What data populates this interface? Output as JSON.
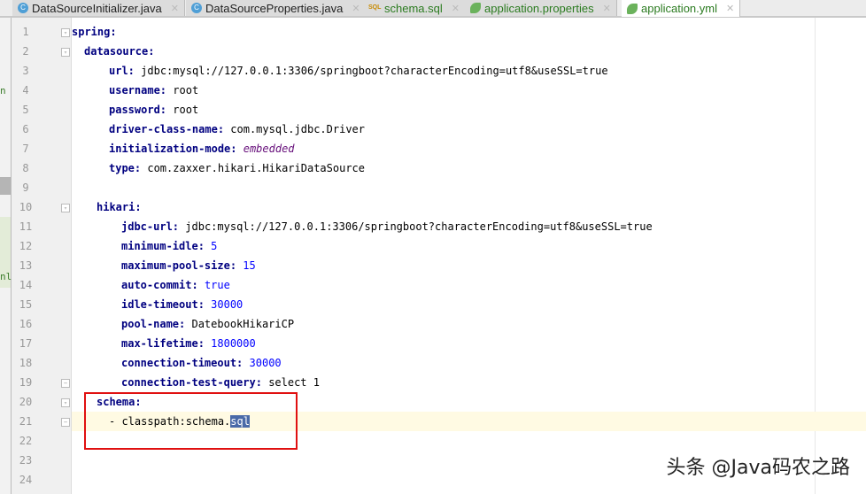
{
  "tabs": [
    {
      "label": "DataSourceInitializer.java",
      "icon": "java-class-icon"
    },
    {
      "label": "DataSourceProperties.java",
      "icon": "java-class-icon"
    },
    {
      "label": "schema.sql",
      "icon": "sql-file-icon"
    },
    {
      "label": "application.properties",
      "icon": "spring-boot-icon"
    },
    {
      "label": "application.yml",
      "icon": "spring-boot-icon",
      "active": true
    }
  ],
  "side": {
    "a": "n",
    "b": "nl"
  },
  "lines": [
    {
      "n": "1",
      "k": "spring:"
    },
    {
      "n": "2",
      "k": "datasource:"
    },
    {
      "n": "3",
      "k": "url:",
      "v": "jdbc:mysql://127.0.0.1:3306/springboot?characterEncoding=utf8&useSSL=true"
    },
    {
      "n": "4",
      "k": "username:",
      "v": "root"
    },
    {
      "n": "5",
      "k": "password:",
      "v": "root"
    },
    {
      "n": "6",
      "k": "driver-class-name:",
      "v": "com.mysql.jdbc.Driver"
    },
    {
      "n": "7",
      "k": "initialization-mode:",
      "v": "embedded"
    },
    {
      "n": "8",
      "k": "type:",
      "v": "com.zaxxer.hikari.HikariDataSource"
    },
    {
      "n": "9"
    },
    {
      "n": "10",
      "k": "hikari:"
    },
    {
      "n": "11",
      "k": "jdbc-url:",
      "v": "jdbc:mysql://127.0.0.1:3306/springboot?characterEncoding=utf8&useSSL=true"
    },
    {
      "n": "12",
      "k": "minimum-idle:",
      "v": "5"
    },
    {
      "n": "13",
      "k": "maximum-pool-size:",
      "v": "15"
    },
    {
      "n": "14",
      "k": "auto-commit:",
      "v": "true"
    },
    {
      "n": "15",
      "k": "idle-timeout:",
      "v": "30000"
    },
    {
      "n": "16",
      "k": "pool-name:",
      "v": "DatebookHikariCP"
    },
    {
      "n": "17",
      "k": "max-lifetime:",
      "v": "1800000"
    },
    {
      "n": "18",
      "k": "connection-timeout:",
      "v": "30000"
    },
    {
      "n": "19",
      "k": "connection-test-query:",
      "v": "select 1"
    },
    {
      "n": "20",
      "k": "schema:"
    },
    {
      "n": "21",
      "v": "- classpath:schema.",
      "sel": "sql"
    },
    {
      "n": "22"
    },
    {
      "n": "23"
    },
    {
      "n": "24"
    }
  ],
  "watermark": "头条 @Java码农之路"
}
